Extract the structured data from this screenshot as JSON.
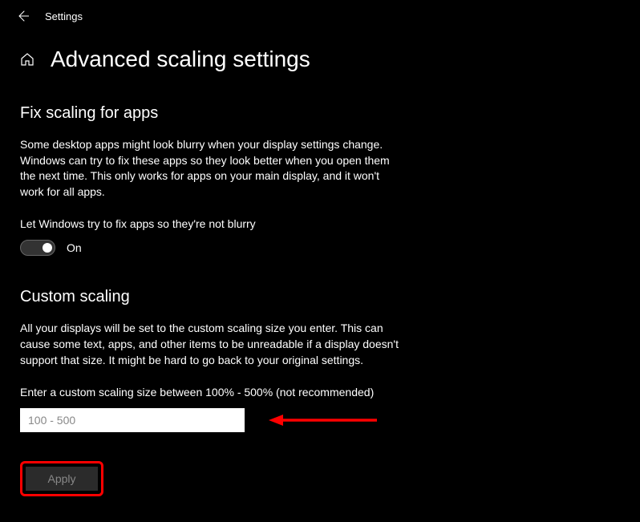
{
  "header": {
    "title": "Settings"
  },
  "page": {
    "title": "Advanced scaling settings"
  },
  "section1": {
    "title": "Fix scaling for apps",
    "description": "Some desktop apps might look blurry when your display settings change. Windows can try to fix these apps so they look better when you open them the next time. This only works for apps on your main display, and it won't work for all apps.",
    "toggle_label": "Let Windows try to fix apps so they're not blurry",
    "toggle_state": "On"
  },
  "section2": {
    "title": "Custom scaling",
    "description": "All your displays will be set to the custom scaling size you enter. This can cause some text, apps, and other items to be unreadable if a display doesn't support that size. It might be hard to go back to your original settings.",
    "input_label": "Enter a custom scaling size between 100% - 500% (not recommended)",
    "input_placeholder": "100 - 500",
    "apply_label": "Apply"
  }
}
